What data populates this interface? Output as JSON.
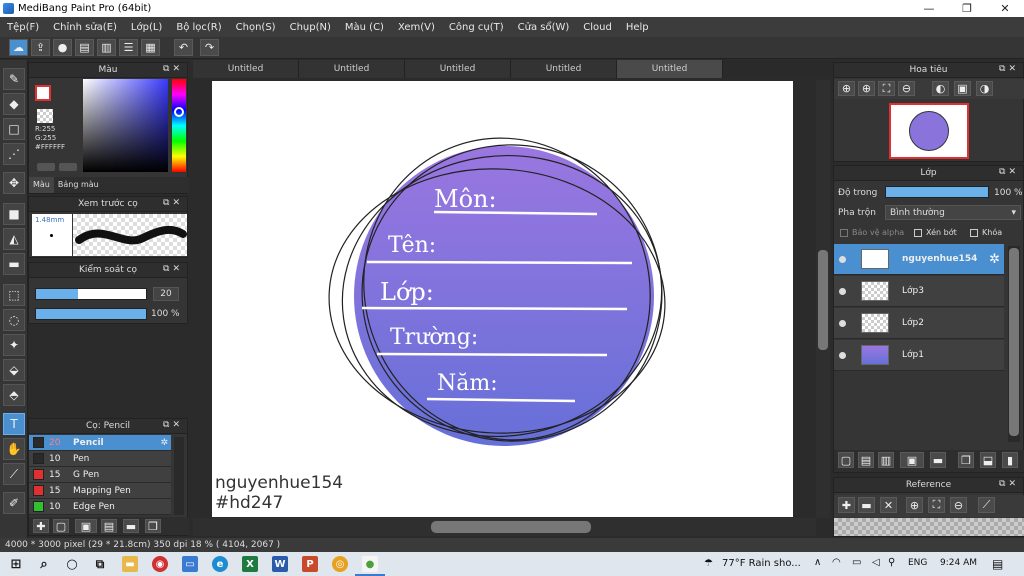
{
  "window": {
    "title": "MediBang Paint Pro (64bit)",
    "min": "—",
    "max": "❐",
    "close": "✕"
  },
  "menu": [
    "Tệp(F)",
    "Chỉnh sửa(E)",
    "Lớp(L)",
    "Bộ lọc(R)",
    "Chọn(S)",
    "Chụp(N)",
    "Màu (C)",
    "Xem(V)",
    "Công cụ(T)",
    "Cửa sổ(W)",
    "Cloud",
    "Help"
  ],
  "tabs": [
    "Untitled",
    "Untitled",
    "Untitled",
    "Untitled",
    "Untitled"
  ],
  "color_panel": {
    "title": "Màu",
    "r": "R:255",
    "g": "G:255",
    "hex": "#FFFFFF",
    "tab_color": "Màu",
    "tab_palette": "Bảng màu"
  },
  "preview_panel": {
    "title": "Xem trước cọ",
    "size": "1.48mm"
  },
  "control_panel": {
    "title": "Kiểm soát cọ",
    "size_value": "20",
    "opacity_value": "100 %",
    "size_fill": 0.38,
    "opacity_fill": 1.0
  },
  "brush_panel": {
    "title": "Cọ: Pencil",
    "brushes": [
      {
        "size": "20",
        "name": "Pencil",
        "color": "#2a2a2a"
      },
      {
        "size": "10",
        "name": "Pen",
        "color": "#2a2a2a"
      },
      {
        "size": "15",
        "name": "G Pen",
        "color": "#e03030"
      },
      {
        "size": "15",
        "name": "Mapping Pen",
        "color": "#e03030"
      },
      {
        "size": "10",
        "name": "Edge Pen",
        "color": "#30c030"
      }
    ]
  },
  "navigator": {
    "title": "Hoa tiêu"
  },
  "layer_panel": {
    "title": "Lớp",
    "opacity_label": "Độ trong",
    "opacity_value": "100 %",
    "blend_label": "Pha trộn",
    "blend_value": "Bình thường",
    "protect_alpha": "Bảo vệ alpha",
    "clipping": "Xén bớt",
    "lock": "Khóa",
    "layers": [
      "nguyenhue154",
      "Lớp3",
      "Lớp2",
      "Lớp1"
    ]
  },
  "reference_panel": {
    "title": "Reference"
  },
  "canvas_text": {
    "mon": "Môn:",
    "ten": "Tên:",
    "lop": "Lớp:",
    "truong": "Trường:",
    "nam": "Năm:",
    "sig1": "nguyenhue154",
    "sig2": "#hd247"
  },
  "status": "4000 * 3000 pixel  (29 * 21.8cm)  350 dpi  18 %  ( 4104, 2067 )",
  "taskbar": {
    "weather": "77°F  Rain sho...",
    "lang": "ENG",
    "time": "9:24 AM"
  },
  "colors": {
    "accent": "#4a8fd0",
    "circle_top": "#9a78e0",
    "circle_bottom": "#6b6fd6"
  }
}
